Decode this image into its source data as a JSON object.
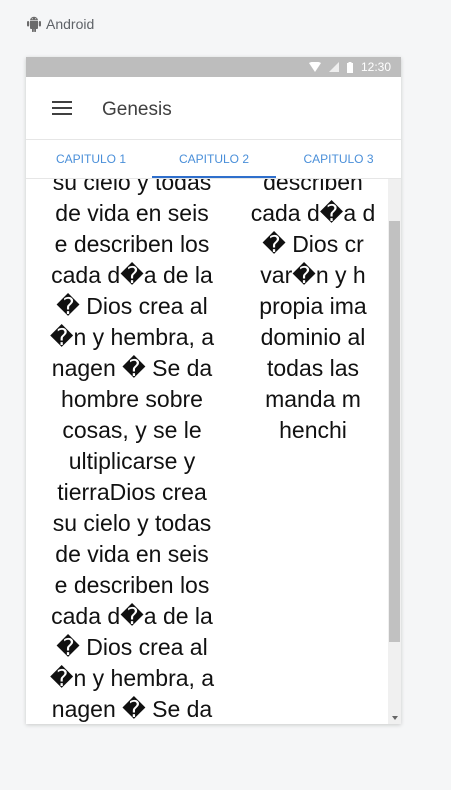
{
  "platform": {
    "label": "Android",
    "icon": "android-icon"
  },
  "status_bar": {
    "time": "12:30",
    "icons": [
      "wifi-icon",
      "signal-icon",
      "battery-icon"
    ]
  },
  "app_bar": {
    "title": "Genesis",
    "menu_icon": "menu-icon"
  },
  "tabs": [
    {
      "label": "CAPITULO 1",
      "selected": false
    },
    {
      "label": "CAPITULO 2",
      "selected": true
    },
    {
      "label": "CAPITULO 3",
      "selected": false
    }
  ],
  "content": {
    "column1": [
      "su cielo y todas",
      "de vida en seis",
      "e describen los",
      "cada d�a de la",
      "� Dios crea al",
      "�n y hembra, a",
      "nagen � Se da",
      "hombre sobre",
      "cosas, y se le",
      "ultiplicarse y",
      "tierraDios crea",
      "su cielo y todas",
      "de vida en seis",
      "e describen los",
      "cada d�a de la",
      "� Dios crea al",
      "�n y hembra, a",
      "nagen � Se da"
    ],
    "column2": [
      "describen",
      "cada d�a d",
      "� Dios cr",
      "var�n y h",
      "propia ima",
      "dominio al",
      "todas las",
      "manda m",
      "henchi"
    ]
  },
  "colors": {
    "accent": "#2f6fcc",
    "tab_text": "#4a8fd9",
    "status_bar": "#bdbdbd"
  }
}
